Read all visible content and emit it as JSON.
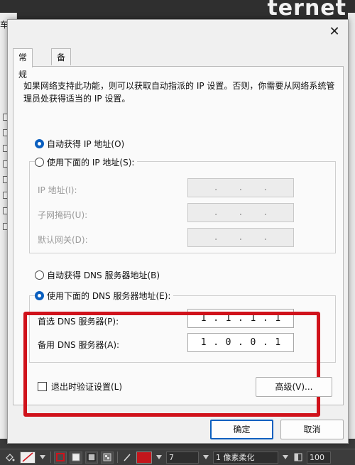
{
  "background": {
    "title_fragment": "ternet",
    "left_fragment": "车"
  },
  "dialog": {
    "tabs": [
      {
        "label": "常规",
        "active": true
      },
      {
        "label": "备用配置",
        "active": false
      }
    ],
    "description": "如果网络支持此功能，则可以获取自动指派的 IP 设置。否则，你需要从网络系统管理员处获得适当的 IP 设置。",
    "ip": {
      "auto_label": "自动获得 IP 地址(O)",
      "auto_selected": true,
      "manual_label": "使用下面的 IP 地址(S):",
      "fields": [
        {
          "label": "IP 地址(I):",
          "value": [
            "",
            "",
            "",
            ""
          ]
        },
        {
          "label": "子网掩码(U):",
          "value": [
            "",
            "",
            "",
            ""
          ]
        },
        {
          "label": "默认网关(D):",
          "value": [
            "",
            "",
            "",
            ""
          ]
        }
      ]
    },
    "dns": {
      "auto_label": "自动获得 DNS 服务器地址(B)",
      "manual_label": "使用下面的 DNS 服务器地址(E):",
      "manual_selected": true,
      "preferred": {
        "label": "首选 DNS 服务器(P):",
        "value": [
          "1",
          "1",
          "1",
          "1"
        ]
      },
      "alternate": {
        "label": "备用 DNS 服务器(A):",
        "value": [
          "1",
          "0",
          "0",
          "1"
        ]
      }
    },
    "validate_label": "退出时验证设置(L)",
    "validate_checked": false,
    "advanced_label": "高级(V)...",
    "ok_label": "确定",
    "cancel_label": "取消",
    "highlight_color": "#d0121b",
    "accent_color": "#0b5fbf"
  },
  "toolbar": {
    "stroke_size": "7",
    "brush_label": "1 像素柔化",
    "zoom": "100"
  }
}
